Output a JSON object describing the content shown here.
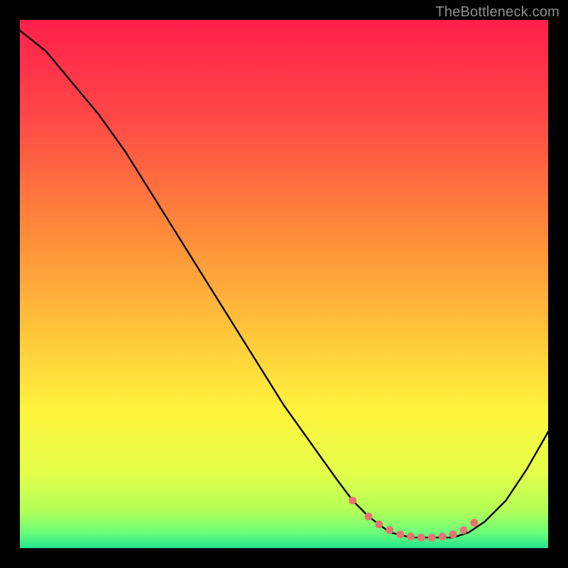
{
  "watermark": "TheBottleneck.com",
  "chart_data": {
    "type": "line",
    "title": "",
    "xlabel": "",
    "ylabel": "",
    "xlim": [
      0,
      100
    ],
    "ylim": [
      0,
      100
    ],
    "grid": false,
    "gradient_stops": [
      {
        "offset": 0,
        "color": "#ff1f4b"
      },
      {
        "offset": 18,
        "color": "#ff4747"
      },
      {
        "offset": 40,
        "color": "#ff8a3a"
      },
      {
        "offset": 58,
        "color": "#ffc23a"
      },
      {
        "offset": 74,
        "color": "#fff43d"
      },
      {
        "offset": 86,
        "color": "#e3ff4a"
      },
      {
        "offset": 93,
        "color": "#b2ff58"
      },
      {
        "offset": 97,
        "color": "#6cff7a"
      },
      {
        "offset": 100,
        "color": "#24e58f"
      }
    ],
    "series": [
      {
        "name": "bottleneck-curve",
        "color": "#000000",
        "x": [
          0,
          5,
          10,
          15,
          20,
          25,
          30,
          35,
          40,
          45,
          50,
          55,
          60,
          63,
          66,
          70,
          74,
          78,
          82,
          85,
          88,
          92,
          96,
          100
        ],
        "values": [
          98,
          94,
          88,
          82,
          75,
          67,
          59,
          51,
          43,
          35,
          27,
          20,
          13,
          9,
          6,
          3,
          2,
          2,
          2,
          3,
          5,
          9,
          15,
          22
        ]
      },
      {
        "name": "optimal-zone-dots",
        "type": "scatter",
        "color": "#e9746d",
        "x": [
          63,
          66,
          68,
          70,
          72,
          74,
          76,
          78,
          80,
          82,
          84,
          86
        ],
        "values": [
          9,
          6,
          4.5,
          3.4,
          2.6,
          2.2,
          2.0,
          2.0,
          2.2,
          2.6,
          3.4,
          4.8
        ]
      }
    ]
  }
}
